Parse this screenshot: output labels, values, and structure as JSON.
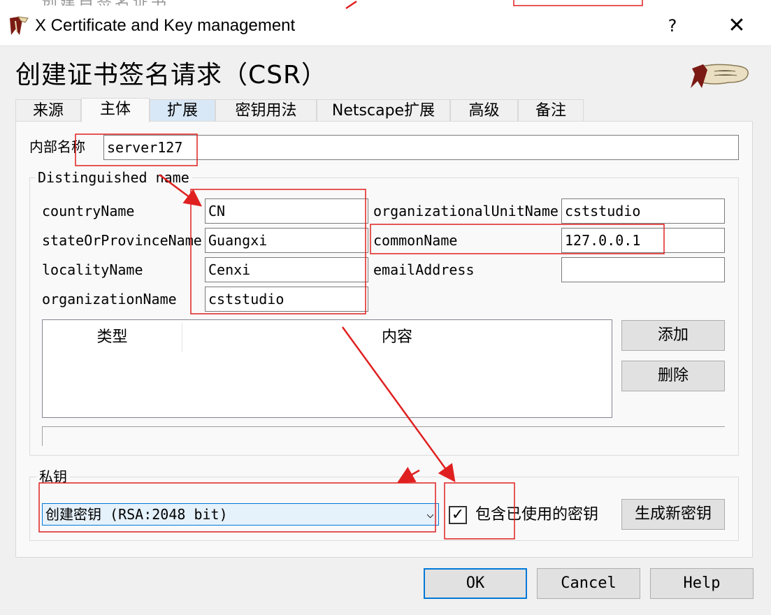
{
  "background_window": {
    "title_fragment": "创建自签名证书"
  },
  "window": {
    "title": "X Certificate and Key management",
    "help_label": "?",
    "close_label": "✕"
  },
  "header": {
    "page_title": "创建证书签名请求（CSR）"
  },
  "tabs": [
    {
      "label": "来源",
      "active": false
    },
    {
      "label": "主体",
      "active": true
    },
    {
      "label": "扩展",
      "active": false,
      "hover": true
    },
    {
      "label": "密钥用法",
      "active": false
    },
    {
      "label": "Netscape扩展",
      "active": false
    },
    {
      "label": "高级",
      "active": false
    },
    {
      "label": "备注",
      "active": false
    }
  ],
  "internal_name": {
    "label": "内部名称",
    "value": "server127"
  },
  "distinguished_name": {
    "title": "Distinguished name",
    "left": [
      {
        "label": "countryName",
        "value": "CN"
      },
      {
        "label": "stateOrProvinceName",
        "value": "Guangxi"
      },
      {
        "label": "localityName",
        "value": "Cenxi"
      },
      {
        "label": "organizationName",
        "value": "cststudio"
      }
    ],
    "right": [
      {
        "label": "organizationalUnitName",
        "value": "cststudio"
      },
      {
        "label": "commonName",
        "value": "127.0.0.1"
      },
      {
        "label": "emailAddress",
        "value": ""
      }
    ],
    "table": {
      "columns": [
        "类型",
        "内容"
      ]
    },
    "add_label": "添加",
    "delete_label": "删除"
  },
  "private_key": {
    "title": "私钥",
    "selected": "创建密钥 (RSA:2048 bit)",
    "include_used_label": "包含已使用的密钥",
    "include_used_checked": true,
    "checkmark": "✓",
    "generate_label": "生成新密钥"
  },
  "footer": {
    "ok_label": "OK",
    "cancel_label": "Cancel",
    "help_label": "Help"
  },
  "colors": {
    "annotation": "#e02020",
    "accent": "#0078d7",
    "tab_hover": "#d9e8f7"
  }
}
